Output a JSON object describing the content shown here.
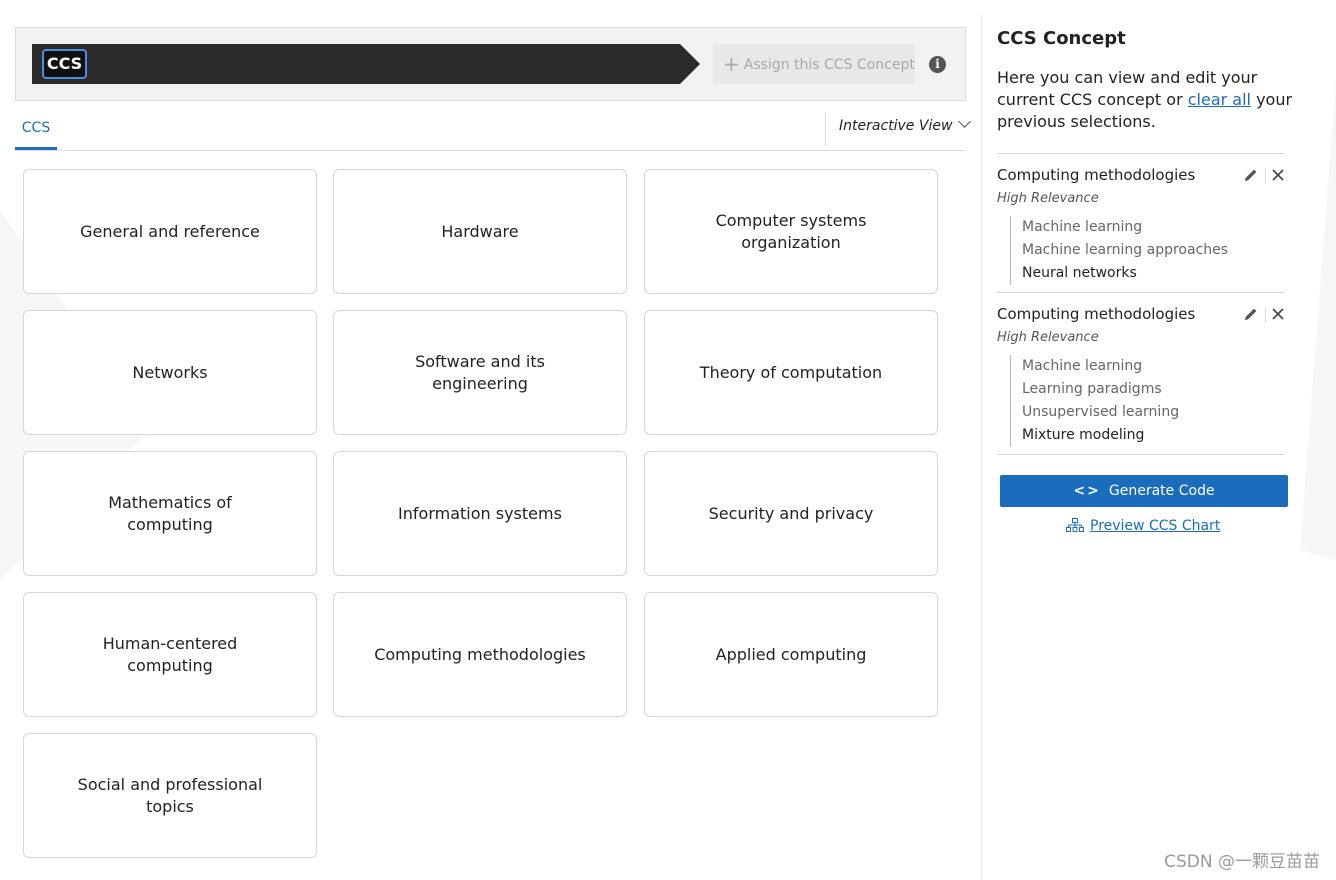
{
  "header": {
    "badge": "CCS",
    "assign_label": "Assign this CCS Concept",
    "info_icon": "info-icon"
  },
  "tabs": [
    {
      "label": "CCS"
    }
  ],
  "view_select": {
    "label": "Interactive View"
  },
  "categories": [
    "General and reference",
    "Hardware",
    "Computer systems organization",
    "Networks",
    "Software and its engineering",
    "Theory of computation",
    "Mathematics of computing",
    "Information systems",
    "Security and privacy",
    "Human-centered computing",
    "Computing methodologies",
    "Applied computing",
    "Social and professional topics"
  ],
  "panel": {
    "title": "CCS Concept",
    "desc_before": "Here you can view and edit your current CCS concept or ",
    "clear_all": "clear all",
    "desc_after": " your previous selections.",
    "concepts": [
      {
        "title": "Computing methodologies",
        "relevance": "High Relevance",
        "path": [
          "Machine learning",
          "Machine learning approaches",
          "Neural networks"
        ]
      },
      {
        "title": "Computing methodologies",
        "relevance": "High Relevance",
        "path": [
          "Machine learning",
          "Learning paradigms",
          "Unsupervised learning",
          "Mixture modeling"
        ]
      }
    ],
    "generate_code": "Generate Code",
    "preview_chart": "Preview CCS Chart"
  },
  "watermark": "CSDN @一颗豆苗苗",
  "colors": {
    "accent": "#1a6cbd",
    "crumb": "#2b2b2b",
    "badge_border": "#4a8fdd"
  }
}
